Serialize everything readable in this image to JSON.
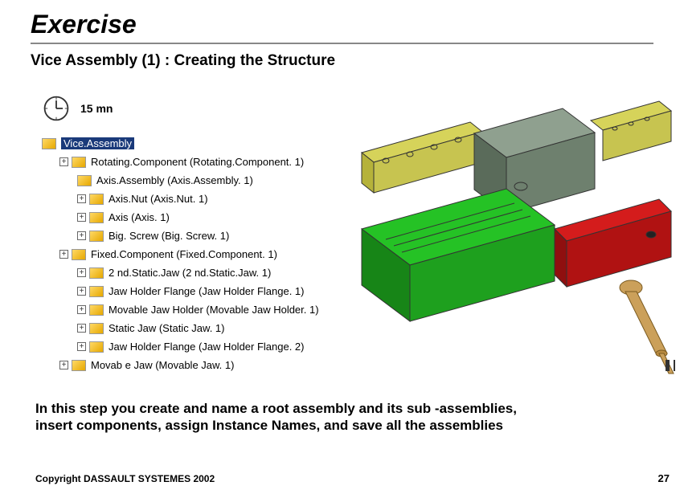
{
  "title": "Exercise",
  "subtitle": "Vice Assembly (1) : Creating the Structure",
  "time": "15 mn",
  "tree": {
    "root": "Vice.Assembly",
    "n1": "Rotating.Component (Rotating.Component. 1)",
    "n2": "Axis.Assembly (Axis.Assembly. 1)",
    "n2a": "Axis.Nut (Axis.Nut. 1)",
    "n2b": "Axis (Axis. 1)",
    "n3": "Big. Screw (Big. Screw. 1)",
    "n4": "Fixed.Component (Fixed.Component. 1)",
    "n4a": "2 nd.Static.Jaw (2 nd.Static.Jaw. 1)",
    "n4b": "Jaw Holder Flange (Jaw Holder Flange. 1)",
    "n4c": "Movable Jaw Holder (Movable Jaw Holder. 1)",
    "n4d": "Static Jaw (Static Jaw. 1)",
    "n4e": "Jaw Holder Flange (Jaw Holder Flange. 2)",
    "n5": "Movab e Jaw (Movable Jaw. 1)"
  },
  "body": "In this step you create and name a root assembly and its sub -assemblies, insert components, assign Instance Names, and save all the assemblies",
  "copyright": "Copyright DASSAULT SYSTEMES 2002",
  "page": "27"
}
